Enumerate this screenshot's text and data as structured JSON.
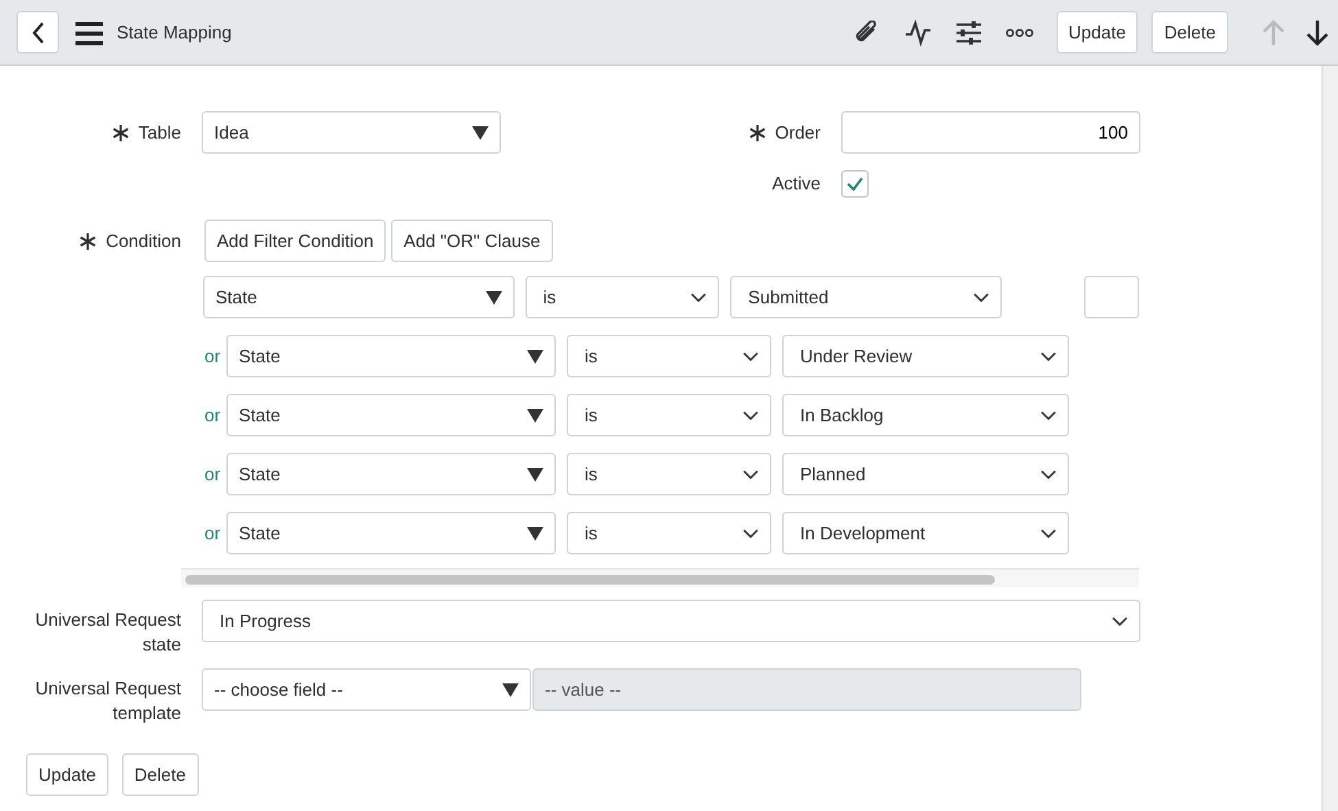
{
  "header": {
    "title": "State Mapping",
    "buttons": [
      {
        "label": "Update"
      },
      {
        "label": "Delete"
      }
    ],
    "previous_disabled": true,
    "next_disabled": false
  },
  "table_field": {
    "label": "Table",
    "required": true,
    "value": "Idea"
  },
  "order_field": {
    "label": "Order",
    "required": true,
    "value": "100"
  },
  "active_field": {
    "label": "Active",
    "checked": true
  },
  "condition": {
    "label": "Condition",
    "required": true,
    "buttons": [
      "Add Filter Condition",
      "Add \"OR\" Clause"
    ],
    "rows": [
      {
        "field": "State",
        "operator": "is",
        "value": "Submitted"
      },
      {
        "connector": "or",
        "field": "State",
        "operator": "is",
        "value": "Under Review"
      },
      {
        "connector": "or",
        "field": "State",
        "operator": "is",
        "value": "In Backlog"
      },
      {
        "connector": "or",
        "field": "State",
        "operator": "is",
        "value": "Planned"
      },
      {
        "connector": "or",
        "field": "State",
        "operator": "is",
        "value": "In Development"
      }
    ]
  },
  "universal_request_state": {
    "label": "Universal Request state",
    "value": "In Progress"
  },
  "universal_request_template": {
    "label": "Universal Request template",
    "field": "-- choose field --",
    "value": "-- value --"
  },
  "footer_buttons": [
    {
      "label": "Update"
    },
    {
      "label": "Delete"
    }
  ]
}
